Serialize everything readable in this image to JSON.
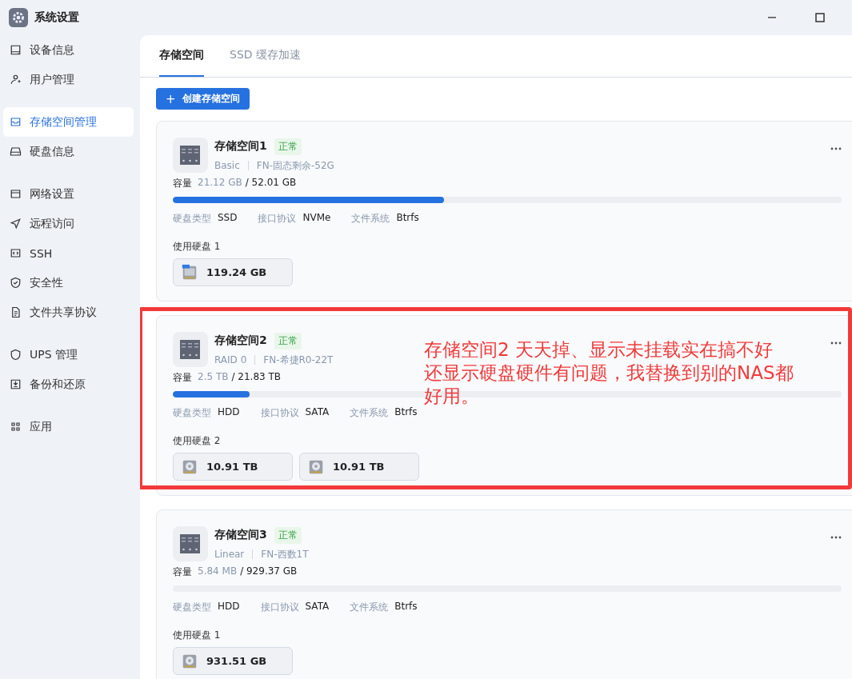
{
  "window": {
    "title": "系统设置"
  },
  "sidebar": {
    "groups": [
      [
        {
          "label": "设备信息",
          "selected": false
        },
        {
          "label": "用户管理",
          "selected": false
        }
      ],
      [
        {
          "label": "存储空间管理",
          "selected": true
        },
        {
          "label": "硬盘信息",
          "selected": false
        }
      ],
      [
        {
          "label": "网络设置",
          "selected": false
        },
        {
          "label": "远程访问",
          "selected": false
        },
        {
          "label": "SSH",
          "selected": false
        },
        {
          "label": "安全性",
          "selected": false
        },
        {
          "label": "文件共享协议",
          "selected": false
        }
      ],
      [
        {
          "label": "UPS 管理",
          "selected": false
        },
        {
          "label": "备份和还原",
          "selected": false
        }
      ],
      [
        {
          "label": "应用",
          "selected": false
        }
      ]
    ]
  },
  "tabs": [
    {
      "label": "存储空间",
      "selected": true
    },
    {
      "label": "SSD 缓存加速",
      "selected": false
    }
  ],
  "create_button": {
    "icon": "+",
    "label": "创建存储空间"
  },
  "pools": [
    {
      "name": "存储空间1",
      "status": "正常",
      "raid": "Basic",
      "volume": "FN-固态剩余-52G",
      "capacity_label": "容量",
      "used": "21.12 GB",
      "total": "/ 52.01 GB",
      "level": 0.406,
      "specs": [
        {
          "label": "硬盘类型",
          "value": "SSD"
        },
        {
          "label": "接口协议",
          "value": "NVMe"
        },
        {
          "label": "文件系统",
          "value": "Btrfs"
        }
      ],
      "disks_label": "使用硬盘 1",
      "disks": [
        {
          "kind": "ssd",
          "size": "119.24 GB"
        }
      ]
    },
    {
      "name": "存储空间2",
      "status": "正常",
      "raid": "RAID 0",
      "volume": "FN-希捷R0-22T",
      "capacity_label": "容量",
      "used": "2.5 TB",
      "total": "/ 21.83 TB",
      "level": 0.115,
      "specs": [
        {
          "label": "硬盘类型",
          "value": "HDD"
        },
        {
          "label": "接口协议",
          "value": "SATA"
        },
        {
          "label": "文件系统",
          "value": "Btrfs"
        }
      ],
      "disks_label": "使用硬盘 2",
      "disks": [
        {
          "kind": "hdd",
          "size": "10.91 TB"
        },
        {
          "kind": "hdd",
          "size": "10.91 TB"
        }
      ],
      "annotation": {
        "lines": [
          "存储空间2 天天掉、显示未挂载实在搞不好",
          "还显示硬盘硬件有问题，我替换到别的NAS都",
          "好用。"
        ]
      }
    },
    {
      "name": "存储空间3",
      "status": "正常",
      "raid": "Linear",
      "volume": "FN-西数1T",
      "capacity_label": "容量",
      "used": "5.84 MB",
      "total": "/ 929.37 GB",
      "specs": [
        {
          "label": "硬盘类型",
          "value": "HDD"
        },
        {
          "label": "接口协议",
          "value": "SATA"
        },
        {
          "label": "文件系统",
          "value": "Btrfs"
        }
      ],
      "disks_label": "使用硬盘 1",
      "disks": [
        {
          "kind": "hdd",
          "size": "931.51 GB"
        }
      ]
    }
  ]
}
